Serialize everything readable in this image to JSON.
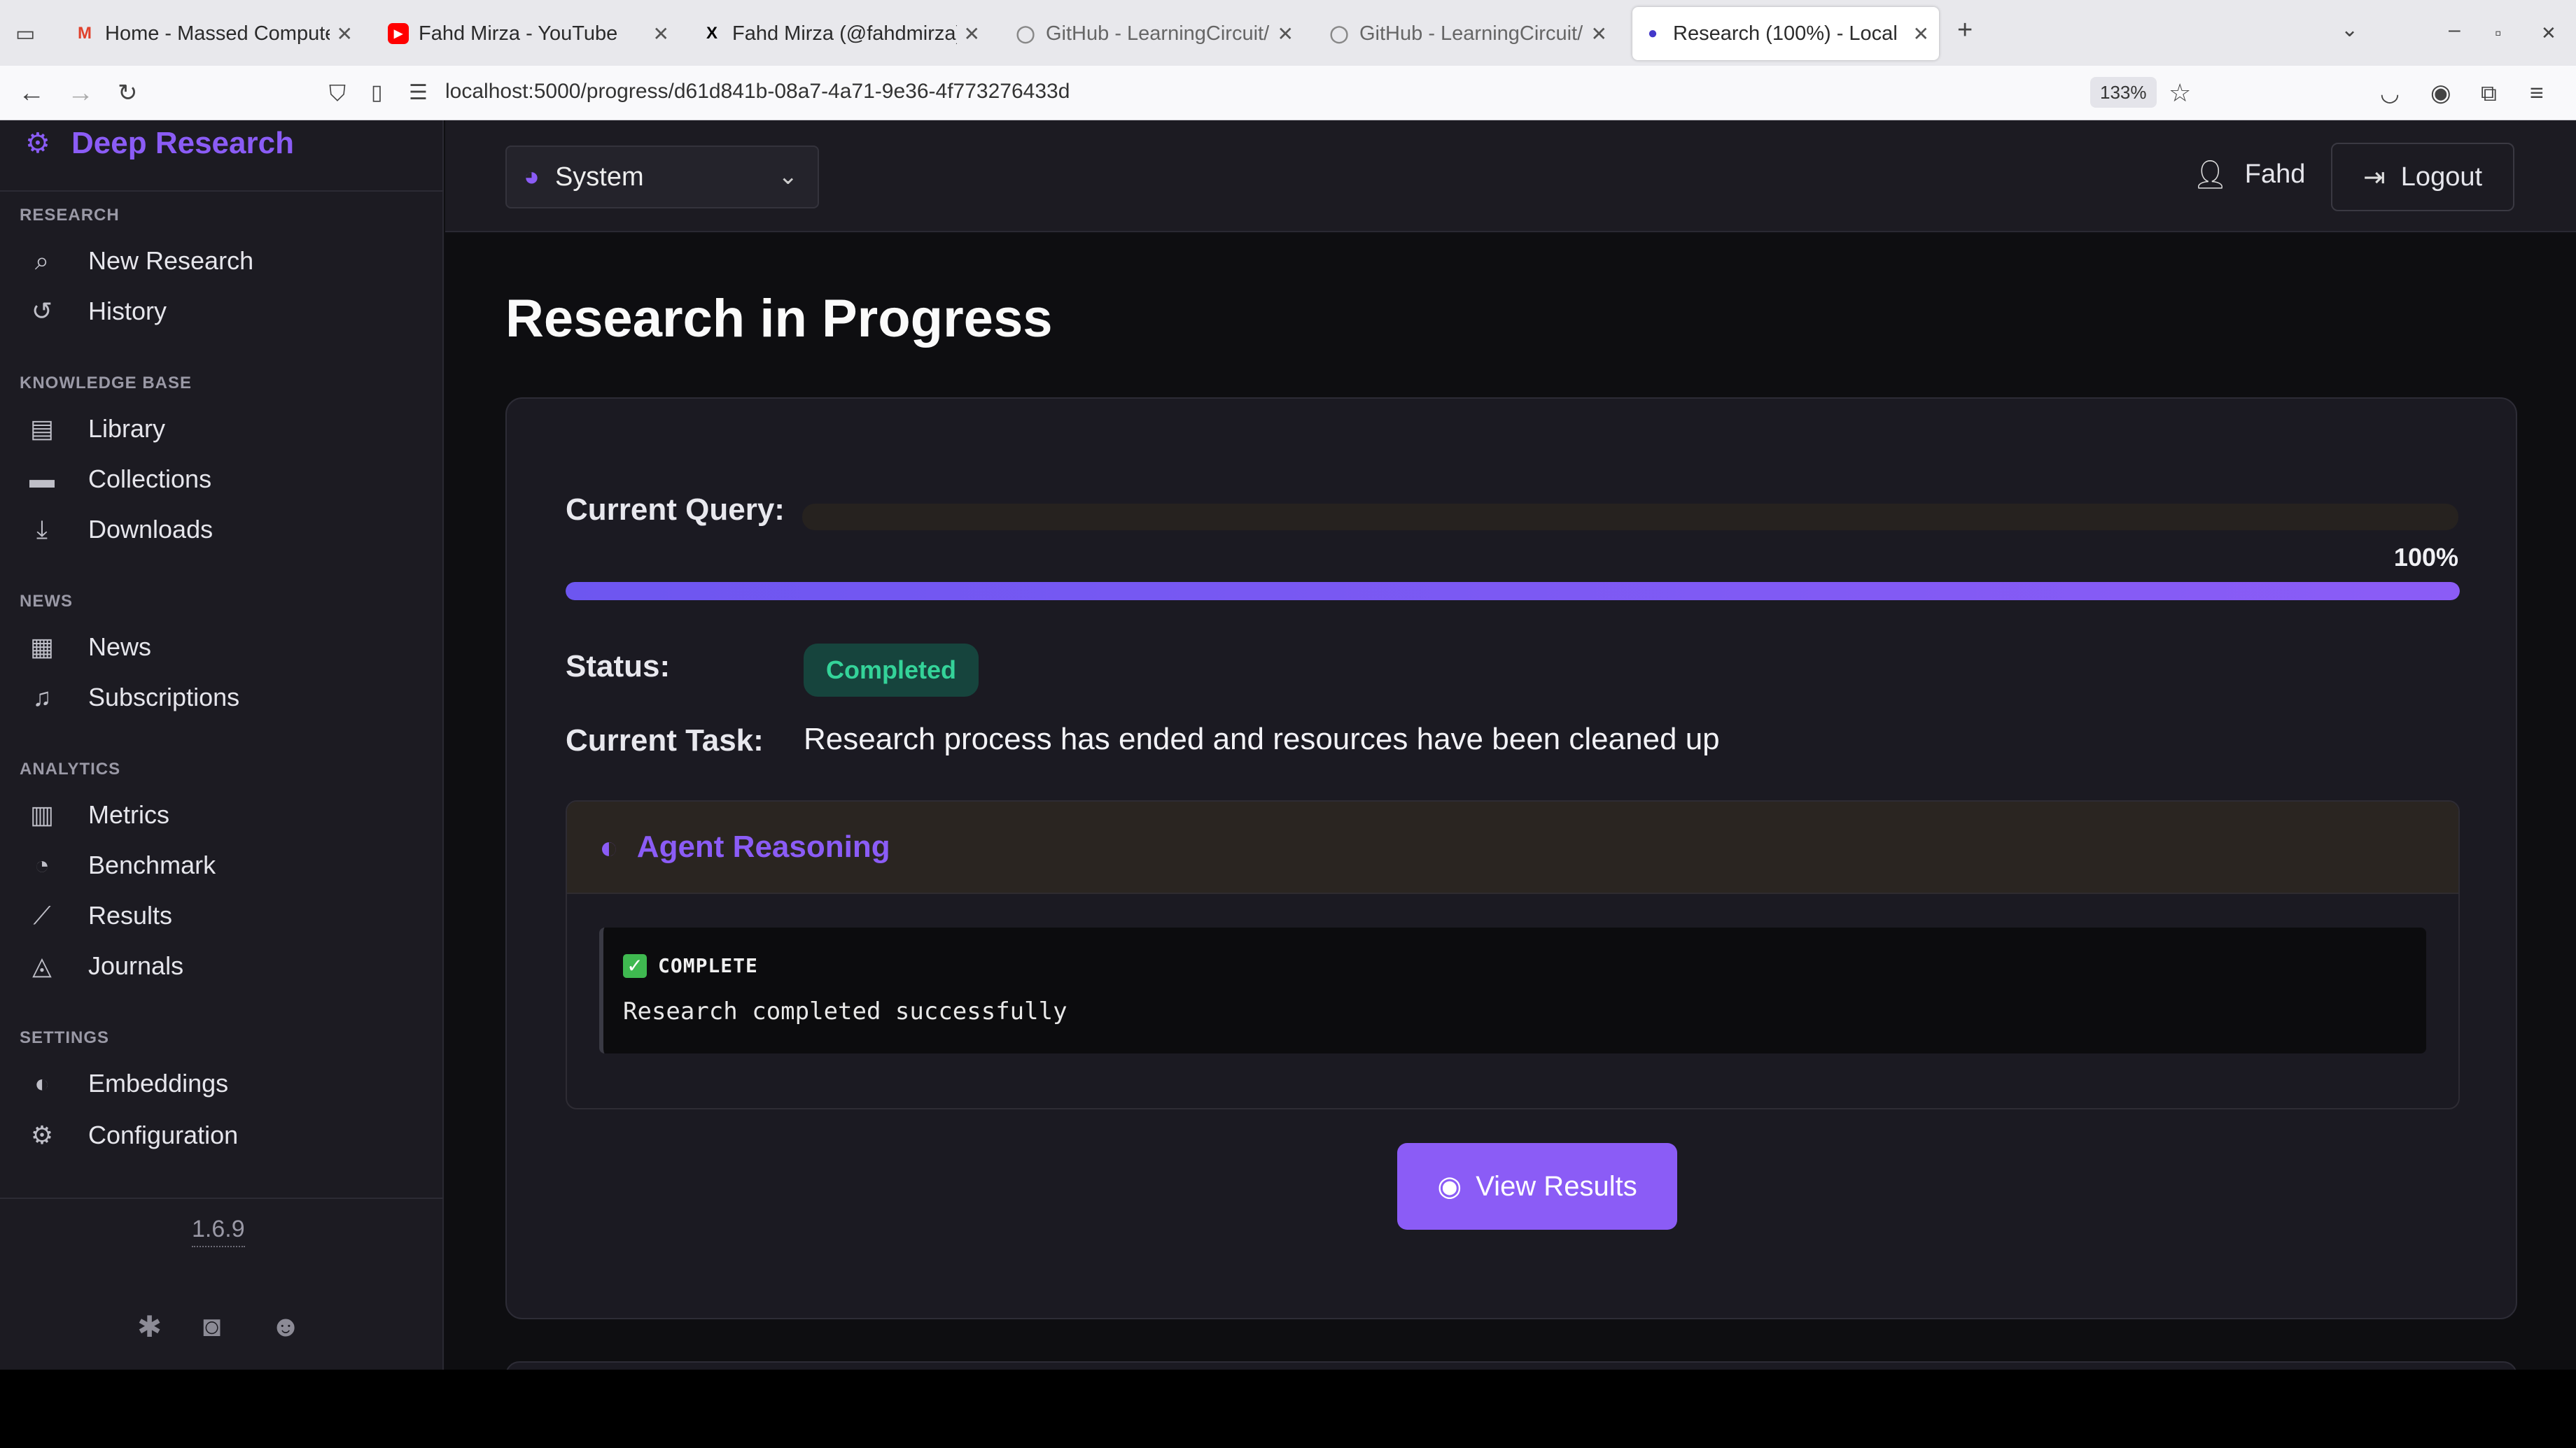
{
  "browser": {
    "tabs": [
      {
        "title": "Home - Massed Compute",
        "favicon": "M"
      },
      {
        "title": "Fahd Mirza - YouTube",
        "favicon": "▶"
      },
      {
        "title": "Fahd Mirza (@fahdmirza)",
        "favicon": "X"
      },
      {
        "title": "GitHub - LearningCircuit/",
        "favicon": "◯"
      },
      {
        "title": "GitHub - LearningCircuit/",
        "favicon": "◯"
      },
      {
        "title": "Research (100%) - Local",
        "favicon": "●"
      }
    ],
    "url": "localhost:5000/progress/d61d841b-08a7-4a71-9e36-4f773276433d",
    "zoom": "133%"
  },
  "sidebar": {
    "brand": "Deep Research",
    "sections": {
      "research": "RESEARCH",
      "knowledge": "KNOWLEDGE BASE",
      "news": "NEWS",
      "analytics": "ANALYTICS",
      "settings": "SETTINGS"
    },
    "items": {
      "new_research": "New Research",
      "history": "History",
      "library": "Library",
      "collections": "Collections",
      "downloads": "Downloads",
      "news": "News",
      "subscriptions": "Subscriptions",
      "metrics": "Metrics",
      "benchmark": "Benchmark",
      "results": "Results",
      "journals": "Journals",
      "embeddings": "Embeddings",
      "configuration": "Configuration"
    },
    "version": "1.6.9"
  },
  "header": {
    "theme": "System",
    "user": "Fahd",
    "logout": "Logout"
  },
  "main": {
    "title": "Research in Progress",
    "current_query_label": "Current Query:",
    "progress_percent": 100,
    "progress_text": "100%",
    "status_label": "Status:",
    "status_value": "Completed",
    "current_task_label": "Current Task:",
    "current_task_value": "Research process has ended and resources have been cleaned up",
    "agent_reasoning_title": "Agent Reasoning",
    "log": {
      "type": "COMPLETE",
      "message": "Research completed successfully"
    },
    "view_results": "View Results"
  },
  "colors": {
    "accent": "#8b5cf6",
    "success": "#34d399",
    "success_bg": "#16443d"
  }
}
